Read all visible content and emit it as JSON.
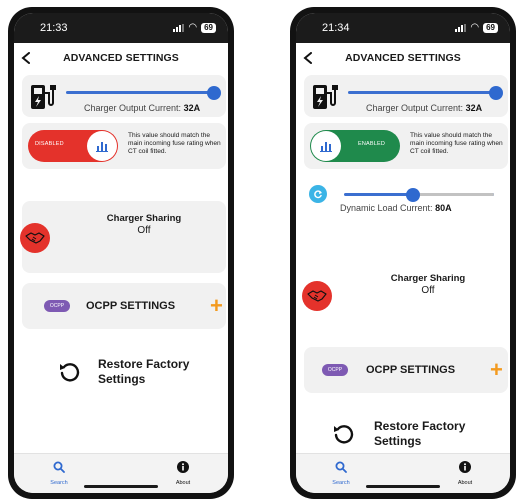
{
  "screens": [
    {
      "status": {
        "time": "21:33",
        "battery": "69"
      },
      "header": {
        "title": "ADVANCED SETTINGS"
      },
      "charger": {
        "caption": "Charger Output Current:",
        "value": "32A",
        "slider_fraction": 1.0
      },
      "toggle": {
        "state_label": "DISABLED",
        "enabled": false
      },
      "ct_note": "This value should match the main incoming fuse rating when CT coil fitted.",
      "sharing": {
        "title": "Charger Sharing",
        "value": "Off"
      },
      "ocpp": {
        "badge": "OCPP",
        "label": "OCPP SETTINGS",
        "plus": "+"
      },
      "restore": {
        "line1": "Restore Factory",
        "line2": "Settings"
      },
      "nav": {
        "search": "Search",
        "about": "About"
      }
    },
    {
      "status": {
        "time": "21:34",
        "battery": "69"
      },
      "header": {
        "title": "ADVANCED SETTINGS"
      },
      "charger": {
        "caption": "Charger Output Current:",
        "value": "32A",
        "slider_fraction": 1.0
      },
      "toggle": {
        "state_label": "ENABLED",
        "enabled": true
      },
      "ct_note": "This value should match the main incoming fuse rating when CT coil fitted.",
      "dynamic": {
        "caption": "Dynamic Load Current:",
        "value": "80A",
        "slider_fraction": 0.46
      },
      "sharing": {
        "title": "Charger Sharing",
        "value": "Off"
      },
      "ocpp": {
        "badge": "OCPP",
        "label": "OCPP SETTINGS",
        "plus": "+"
      },
      "restore": {
        "line1": "Restore Factory",
        "line2": "Settings"
      },
      "nav": {
        "search": "Search",
        "about": "About"
      }
    }
  ],
  "colors": {
    "accent_blue": "#2f69cf",
    "disabled_red": "#e4322b",
    "enabled_green": "#1f8a4c",
    "plus_orange": "#f39a1f",
    "ocpp_purple": "#7e5ab3",
    "dynamic_blue": "#3bb4e6"
  },
  "icons": [
    "back-chevron-icon",
    "ev-charger-icon",
    "bar-chart-icon",
    "handshake-icon",
    "ocpp-logo-icon",
    "plus-icon",
    "restore-icon",
    "search-icon",
    "info-icon",
    "refresh-icon"
  ]
}
